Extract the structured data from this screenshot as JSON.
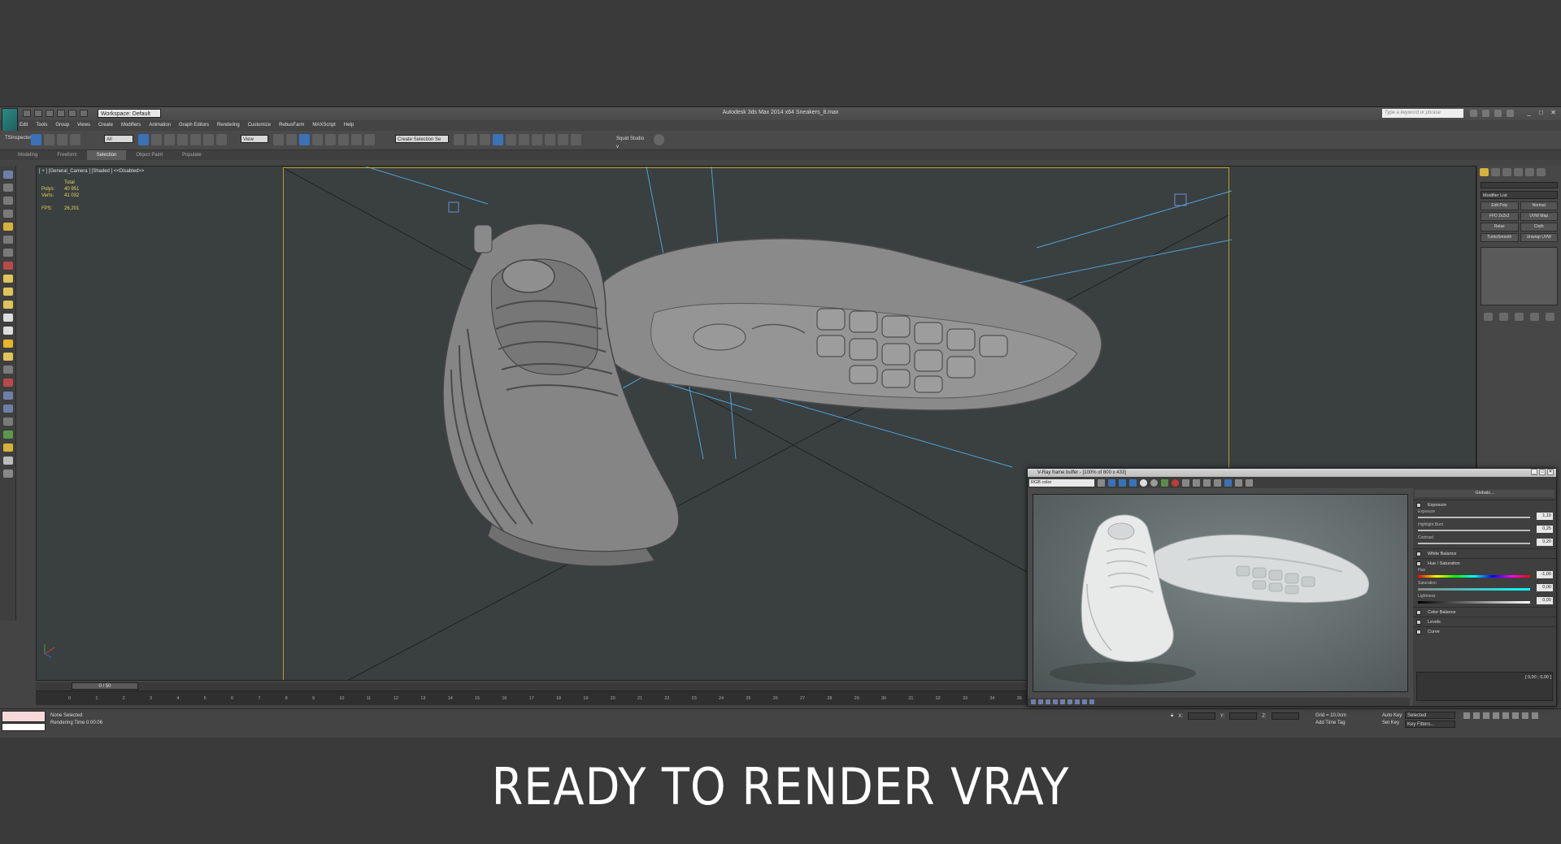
{
  "app": {
    "window_title": "Autodesk 3ds Max  2014 x64    Sneakers_8.max",
    "workspace": "Workspace: Default",
    "search_placeholder": "Type a keyword or phrase"
  },
  "menu": [
    "Edit",
    "Tools",
    "Group",
    "Views",
    "Create",
    "Modifiers",
    "Animation",
    "Graph Editors",
    "Rendering",
    "Customize",
    "RebusFarm",
    "MAXScript",
    "Help"
  ],
  "toolbar": {
    "filter": "All",
    "coord_system": "View",
    "selection_set": "Create Selection Se",
    "squid_label": "Squid Studio v"
  },
  "ribbon": {
    "inspector": "TSInspector",
    "tabs": [
      "Modeling",
      "Freeform",
      "Selection",
      "Object Paint",
      "Populate"
    ],
    "active_tab": "Selection"
  },
  "viewport": {
    "label": "[ + ] [General_Camera ] [Shaded ] <<Disabled>>",
    "stats": {
      "header": "Total",
      "polys_label": "Polys:",
      "polys": "40 951",
      "verts_label": "Verts:",
      "verts": "41 032",
      "fps_label": "FPS:",
      "fps": "26,201"
    }
  },
  "command_panel": {
    "modifier_list": "Modifier List",
    "buttons": [
      "Edit Poly",
      "Normal",
      "FFD 2x2x2",
      "UVW Map",
      "Relax",
      "Cloth",
      "TurboSmooth",
      "Unwrap UVW"
    ]
  },
  "timeline": {
    "slider": "0 / 50",
    "ticks": [
      "0",
      "1",
      "2",
      "3",
      "4",
      "5",
      "6",
      "7",
      "8",
      "9",
      "10",
      "11",
      "12",
      "13",
      "14",
      "15",
      "16",
      "17",
      "18",
      "19",
      "20",
      "21",
      "22",
      "23",
      "24",
      "25",
      "26",
      "27",
      "28",
      "29",
      "30",
      "31",
      "32",
      "33",
      "34",
      "35",
      "36"
    ]
  },
  "status": {
    "selection": "None Selected",
    "render_time": "Rendering Time  0:00:06",
    "x_label": "X:",
    "y_label": "Y:",
    "z_label": "Z:",
    "grid": "Grid = 10,0cm",
    "add_time_tag": "Add Time Tag",
    "auto_key": "Auto Key",
    "set_key": "Set Key",
    "key_mode": "Selected",
    "key_filters": "Key Filters..."
  },
  "vfb": {
    "title": "V-Ray frame buffer - [100% of 800 x 433]",
    "channel": "RGB color",
    "globals": "Globals...",
    "exposure": "Exposure",
    "exposure_label": "Exposure",
    "exposure_val": "1,10",
    "highlight_label": "Highlight Burn",
    "highlight_val": "0,25",
    "contrast_label": "Contrast",
    "contrast_val": "0,20",
    "white_balance": "White Balance",
    "hue_sat": "Hue / Saturation",
    "hue_label": "Hue",
    "hue_val": "-1,00",
    "sat_label": "Saturation",
    "sat_val": "0,00",
    "light_label": "Lightness",
    "light_val": "0,00",
    "color_balance": "Color Balance",
    "levels": "Levels",
    "curve": "Curve",
    "curve_val": "[ 0,00 ; 0,00 ]"
  },
  "caption": "READY TO RENDER  VRAY",
  "colors": {
    "safe_frame": "#b5a227",
    "camera_lines": "#4da3d8",
    "stats_text": "#e8d65a"
  }
}
